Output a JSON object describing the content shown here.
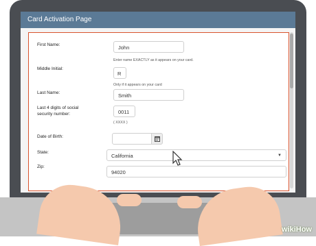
{
  "page": {
    "title": "Card Activation Page"
  },
  "form": {
    "first_name": {
      "label": "First Name:",
      "value": "John",
      "hint": "Enter name EXACTLY as it appears on your card."
    },
    "middle_initial": {
      "label": "Middle Initial:",
      "value": "R",
      "hint": "Only if it appears on your card"
    },
    "last_name": {
      "label": "Last Name:",
      "value": "Smith"
    },
    "ssn_last4": {
      "label_line1": "Last 4 digits of social",
      "label_line2": "security number:",
      "value": "0011",
      "hint": "( XXXX )"
    },
    "dob": {
      "label": "Date of Birth:",
      "value": ""
    },
    "state": {
      "label": "State:",
      "value": "California"
    },
    "zip": {
      "label": "Zip:",
      "value": "94020"
    }
  },
  "watermark": {
    "text": "wikiHow"
  },
  "colors": {
    "title_bar": "#5b7a96",
    "panel_border": "#d9522c",
    "laptop": "#4a4d52"
  },
  "icons": {
    "calendar": "calendar-icon",
    "dropdown": "chevron-down-icon",
    "cursor": "mouse-cursor-icon"
  }
}
